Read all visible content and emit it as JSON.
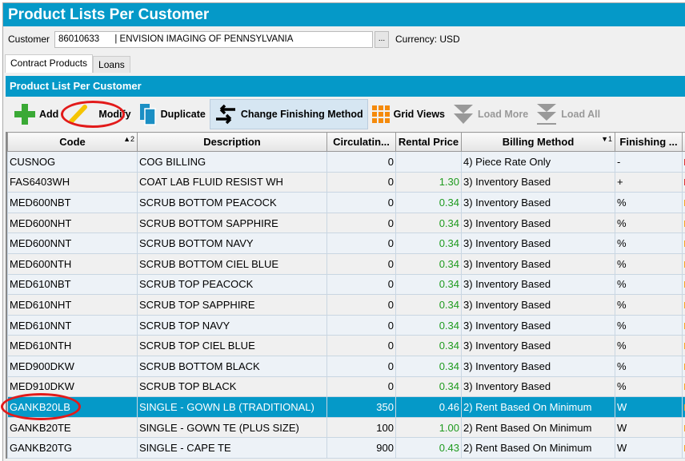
{
  "title": "Product Lists Per Customer",
  "customer": {
    "label": "Customer",
    "value": "86010633      | ENVISION IMAGING OF PENNSYLVANIA",
    "browse": "...",
    "currency_label": "Currency:",
    "currency": "USD"
  },
  "tabs": [
    "Contract Products",
    "Loans"
  ],
  "panel_title": "Product List Per Customer",
  "toolbar": {
    "add": "Add",
    "modify": "Modify",
    "duplicate": "Duplicate",
    "change": "Change Finishing Method",
    "grid": "Grid Views",
    "load_more": "Load More",
    "load_all": "Load All"
  },
  "columns": {
    "code": "Code",
    "code_sort": "2",
    "desc": "Description",
    "circ": "Circulatin...",
    "price": "Rental Price",
    "billing": "Billing Method",
    "billing_sort": "1",
    "finishing": "Finishing ..."
  },
  "rows": [
    {
      "code": "CUSNOG",
      "desc": "COG BILLING",
      "circ": "0",
      "price": "",
      "billing": "4) Piece Rate Only",
      "fin": "-"
    },
    {
      "code": "FAS6403WH",
      "desc": "COAT LAB FLUID RESIST WH",
      "circ": "0",
      "price": "1.30",
      "billing": "3) Inventory Based",
      "fin": "+"
    },
    {
      "code": "MED600NBT",
      "desc": "SCRUB BOTTOM PEACOCK",
      "circ": "0",
      "price": "0.34",
      "billing": "3) Inventory Based",
      "fin": "%"
    },
    {
      "code": "MED600NHT",
      "desc": "SCRUB BOTTOM SAPPHIRE",
      "circ": "0",
      "price": "0.34",
      "billing": "3) Inventory Based",
      "fin": "%"
    },
    {
      "code": "MED600NNT",
      "desc": "SCRUB BOTTOM NAVY",
      "circ": "0",
      "price": "0.34",
      "billing": "3) Inventory Based",
      "fin": "%"
    },
    {
      "code": "MED600NTH",
      "desc": "SCRUB BOTTOM CIEL BLUE",
      "circ": "0",
      "price": "0.34",
      "billing": "3) Inventory Based",
      "fin": "%"
    },
    {
      "code": "MED610NBT",
      "desc": "SCRUB TOP PEACOCK",
      "circ": "0",
      "price": "0.34",
      "billing": "3) Inventory Based",
      "fin": "%"
    },
    {
      "code": "MED610NHT",
      "desc": "SCRUB TOP SAPPHIRE",
      "circ": "0",
      "price": "0.34",
      "billing": "3) Inventory Based",
      "fin": "%"
    },
    {
      "code": "MED610NNT",
      "desc": "SCRUB TOP NAVY",
      "circ": "0",
      "price": "0.34",
      "billing": "3) Inventory Based",
      "fin": "%"
    },
    {
      "code": "MED610NTH",
      "desc": "SCRUB TOP CIEL BLUE",
      "circ": "0",
      "price": "0.34",
      "billing": "3) Inventory Based",
      "fin": "%"
    },
    {
      "code": "MED900DKW",
      "desc": "SCRUB BOTTOM BLACK",
      "circ": "0",
      "price": "0.34",
      "billing": "3) Inventory Based",
      "fin": "%"
    },
    {
      "code": "MED910DKW",
      "desc": "SCRUB TOP BLACK",
      "circ": "0",
      "price": "0.34",
      "billing": "3) Inventory Based",
      "fin": "%"
    },
    {
      "code": "GANKB20LB",
      "desc": "SINGLE - GOWN LB (TRADITIONAL)",
      "circ": "350",
      "price": "0.46",
      "billing": "2) Rent Based On Minimum",
      "fin": "W"
    },
    {
      "code": "GANKB20TE",
      "desc": "SINGLE - GOWN TE (PLUS SIZE)",
      "circ": "100",
      "price": "1.00",
      "billing": "2) Rent Based On Minimum",
      "fin": "W"
    },
    {
      "code": "GANKB20TG",
      "desc": "SINGLE - CAPE TE",
      "circ": "900",
      "price": "0.43",
      "billing": "2) Rent Based On Minimum",
      "fin": "W"
    }
  ],
  "selected_row": 12
}
